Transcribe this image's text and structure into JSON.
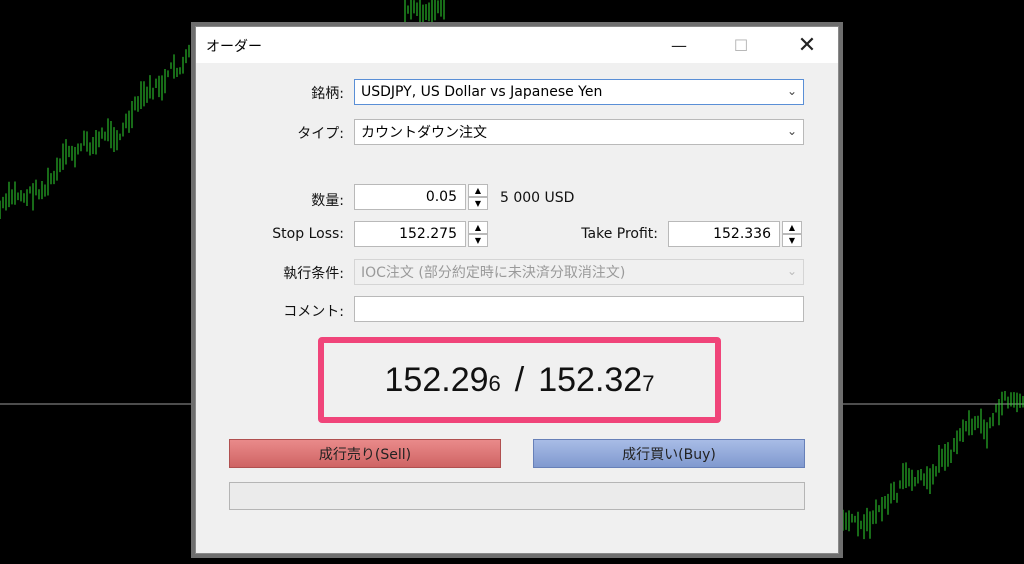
{
  "window": {
    "title": "オーダー"
  },
  "form": {
    "symbol_label": "銘柄:",
    "symbol_value": "USDJPY, US Dollar vs Japanese Yen",
    "type_label": "タイプ:",
    "type_value": "カウントダウン注文",
    "volume_label": "数量:",
    "volume_value": "0.05",
    "volume_unit": "5 000 USD",
    "stoploss_label": "Stop Loss:",
    "stoploss_value": "152.275",
    "takeprofit_label": "Take Profit:",
    "takeprofit_value": "152.336",
    "fill_label": "執行条件:",
    "fill_value": "IOC注文 (部分約定時に未決済分取消注文)",
    "comment_label": "コメント:",
    "comment_value": ""
  },
  "quote": {
    "bid_main": "152.29",
    "bid_small": "6",
    "separator": "/",
    "ask_main": "152.32",
    "ask_small": "7"
  },
  "buttons": {
    "sell_label": "成行売り(Sell)",
    "buy_label": "成行買い(Buy)"
  },
  "colors": {
    "highlight": "#f0457a",
    "sell": "#e07a7a",
    "buy": "#93aadc",
    "candle": "#33cc33"
  }
}
